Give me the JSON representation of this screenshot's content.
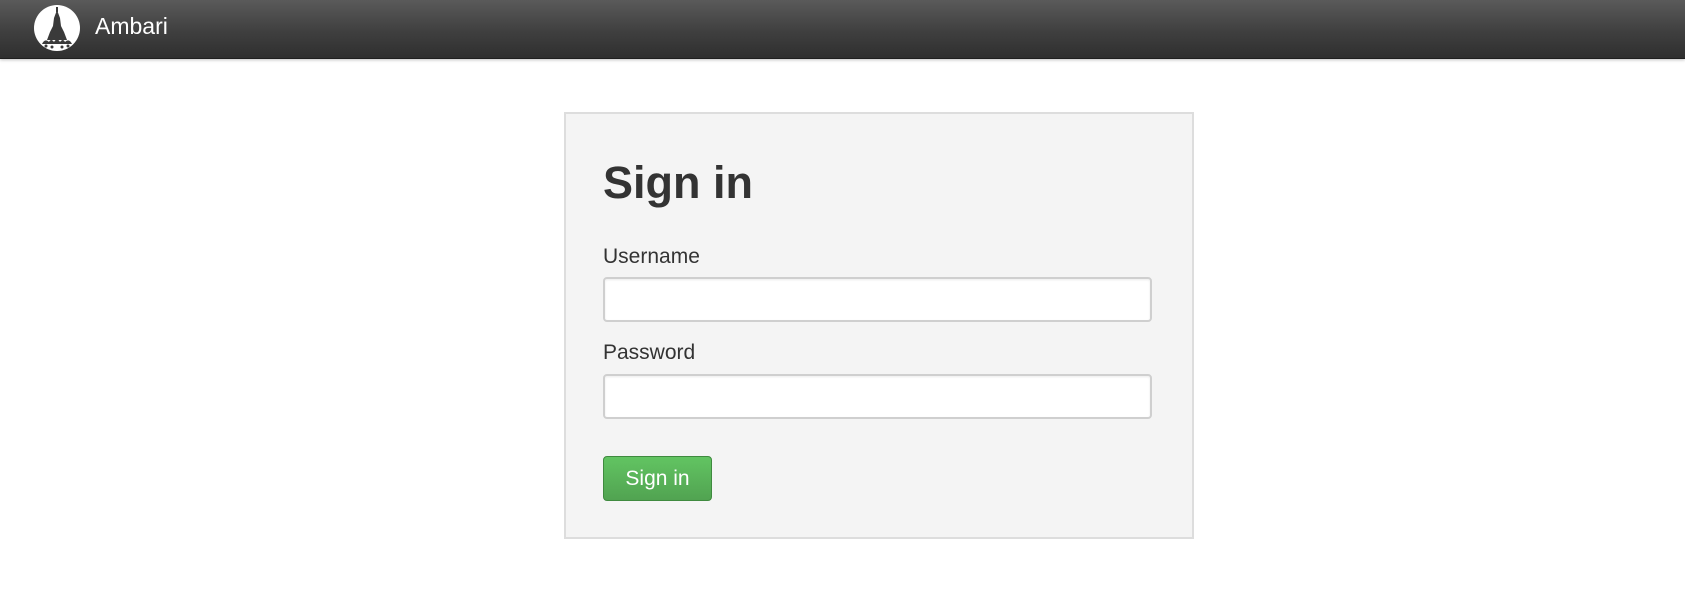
{
  "header": {
    "brand": "Ambari",
    "logo_icon": "ambari-elephant-logo-icon"
  },
  "login": {
    "title": "Sign in",
    "username_label": "Username",
    "username_value": "",
    "password_label": "Password",
    "password_value": "",
    "submit_label": "Sign in"
  },
  "colors": {
    "topbar": "#3f3f3f",
    "panel_background": "#f4f4f4",
    "panel_border": "#dddddd",
    "button_green": "#51a351",
    "text": "#333333"
  }
}
